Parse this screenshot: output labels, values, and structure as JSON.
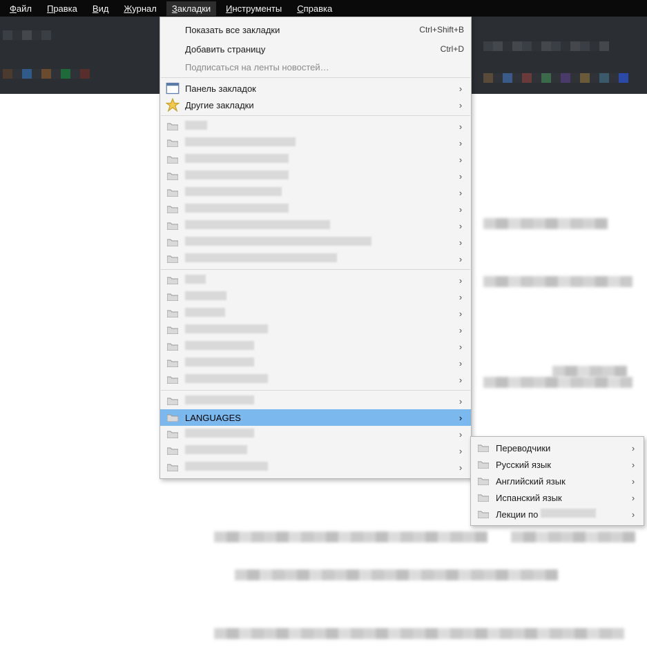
{
  "menubar": {
    "file": {
      "pre": "",
      "u": "Ф",
      "post": "айл"
    },
    "edit": {
      "pre": "",
      "u": "П",
      "post": "равка"
    },
    "view": {
      "pre": "",
      "u": "В",
      "post": "ид"
    },
    "history": {
      "pre": "",
      "u": "Ж",
      "post": "урнал"
    },
    "bookmarks": {
      "pre": "",
      "u": "З",
      "post": "акладки"
    },
    "tools": {
      "pre": "",
      "u": "И",
      "post": "нструменты"
    },
    "help": {
      "pre": "",
      "u": "С",
      "post": "правка"
    }
  },
  "dropdown": {
    "show_all": {
      "label": "Показать все закладки",
      "shortcut": "Ctrl+Shift+B"
    },
    "add_page": {
      "label": "Добавить страницу",
      "shortcut": "Ctrl+D"
    },
    "subscribe": {
      "label": "Подписаться на ленты новостей…"
    },
    "toolbar": {
      "label": "Панель закладок"
    },
    "other": {
      "label": "Другие закладки"
    },
    "languages": {
      "label": "LANGUAGES"
    },
    "blur_widths": [
      32,
      160,
      150,
      150,
      140,
      150,
      210,
      270,
      220,
      30,
      60,
      58,
      120,
      100,
      100,
      120,
      100,
      100,
      90,
      120
    ]
  },
  "submenu": {
    "items": [
      "Переводчики",
      "Русский язык",
      "Английский язык",
      "Испанский язык",
      "Лекции по"
    ],
    "last_blur_w": 80
  }
}
